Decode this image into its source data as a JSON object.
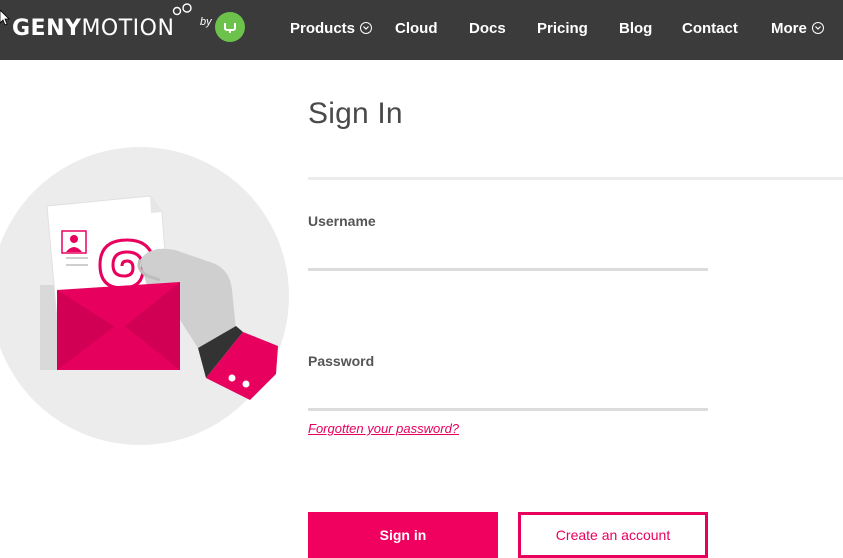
{
  "header": {
    "logo_bold": "GENY",
    "logo_light": "MOTION",
    "logo_by": "by",
    "nav": [
      {
        "label": "Products",
        "has_chevron": true
      },
      {
        "label": "Cloud",
        "has_chevron": false
      },
      {
        "label": "Docs",
        "has_chevron": false
      },
      {
        "label": "Pricing",
        "has_chevron": false
      },
      {
        "label": "Blog",
        "has_chevron": false
      },
      {
        "label": "Contact",
        "has_chevron": false
      },
      {
        "label": "More",
        "has_chevron": true
      }
    ]
  },
  "form": {
    "title": "Sign In",
    "username_label": "Username",
    "username_value": "",
    "password_label": "Password",
    "password_value": "",
    "forgot_link": "Forgotten your password?",
    "signin_button": "Sign in",
    "create_button": "Create an account"
  },
  "colors": {
    "brand": "#f0005f",
    "header_bg": "#3b3b3b",
    "badge": "#6cc24a"
  }
}
